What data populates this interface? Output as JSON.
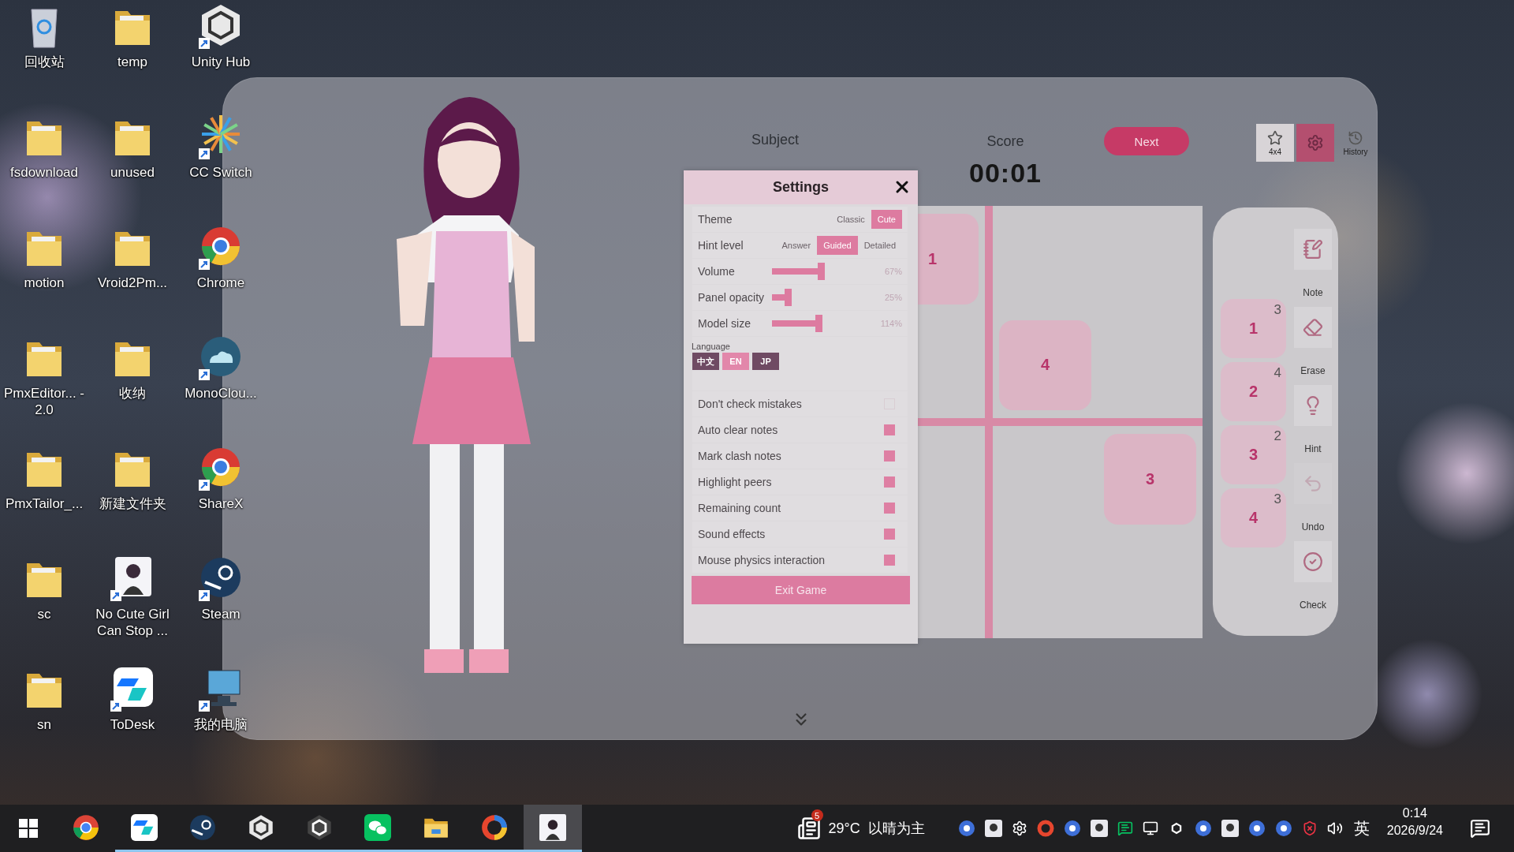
{
  "desktop_icons": [
    {
      "kind": "recycle-bin",
      "label": "回收站",
      "shortcut": false
    },
    {
      "kind": "folder",
      "label": "fsdownload",
      "shortcut": false
    },
    {
      "kind": "folder",
      "label": "motion",
      "shortcut": false
    },
    {
      "kind": "folder",
      "label": "PmxEditor... - 2.0",
      "shortcut": false
    },
    {
      "kind": "folder",
      "label": "PmxTailor_...",
      "shortcut": false
    },
    {
      "kind": "folder",
      "label": "sc",
      "shortcut": false
    },
    {
      "kind": "folder",
      "label": "sn",
      "shortcut": false
    },
    {
      "kind": "folder",
      "label": "temp",
      "shortcut": false
    },
    {
      "kind": "folder",
      "label": "unused",
      "shortcut": false
    },
    {
      "kind": "folder",
      "label": "Vroid2Pm...",
      "shortcut": false
    },
    {
      "kind": "folder",
      "label": "收纳",
      "shortcut": false
    },
    {
      "kind": "folder",
      "label": "新建文件夹",
      "shortcut": false
    },
    {
      "kind": "portrait",
      "label": "No Cute Girl Can Stop ...",
      "shortcut": true
    },
    {
      "kind": "remote",
      "label": "ToDesk",
      "shortcut": true
    },
    {
      "kind": "cube",
      "label": "Unity Hub",
      "shortcut": true
    },
    {
      "kind": "pinwheel",
      "label": "CC Switch",
      "shortcut": true
    },
    {
      "kind": "ring",
      "label": "Chrome",
      "shortcut": true
    },
    {
      "kind": "cloud",
      "label": "MonoClou...",
      "shortcut": true
    },
    {
      "kind": "ring",
      "label": "ShareX",
      "shortcut": true
    },
    {
      "kind": "steam",
      "label": "Steam",
      "shortcut": true
    },
    {
      "kind": "computer",
      "label": "我的电脑",
      "shortcut": true
    }
  ],
  "game": {
    "subject_label": "Subject",
    "score_label": "Score",
    "timer": "00:01",
    "next_button": "Next",
    "toolbar": [
      {
        "kind": "size",
        "label": "4x4",
        "selected": false
      },
      {
        "kind": "settings",
        "selected": true
      },
      {
        "kind": "history",
        "label": "History",
        "selected": false
      }
    ],
    "board": [
      [
        {
          "given": true,
          "value": "1"
        },
        {
          "given": false
        },
        {
          "given": false
        }
      ],
      [
        {
          "given": false
        },
        {
          "given": true,
          "value": "4"
        },
        {
          "given": false
        }
      ],
      [
        {
          "given": false
        },
        {
          "given": false
        },
        {
          "given": true,
          "value": "3"
        }
      ],
      [
        {
          "given": false
        },
        {
          "given": false
        },
        {
          "given": false
        }
      ]
    ],
    "number_pad": [
      {
        "digit": "1",
        "remaining": "3"
      },
      {
        "digit": "2",
        "remaining": "4"
      },
      {
        "digit": "3",
        "remaining": "2"
      },
      {
        "digit": "4",
        "remaining": "3"
      }
    ],
    "tools": [
      {
        "kind": "note",
        "label": "Note",
        "disabled": false
      },
      {
        "kind": "erase",
        "label": "Erase",
        "disabled": false
      },
      {
        "kind": "hint",
        "label": "Hint",
        "disabled": false
      },
      {
        "kind": "undo",
        "label": "Undo",
        "disabled": true
      },
      {
        "kind": "check",
        "label": "Check",
        "disabled": false
      }
    ]
  },
  "settings": {
    "title": "Settings",
    "rows": [
      {
        "kind": "choice",
        "label": "Theme",
        "options": [
          {
            "label": "Classic",
            "selected": false
          },
          {
            "label": "Cute",
            "selected": true
          }
        ]
      },
      {
        "kind": "choice",
        "label": "Hint level",
        "options": [
          {
            "label": "Answer",
            "selected": false
          },
          {
            "label": "Guided",
            "selected": true
          },
          {
            "label": "Detailed",
            "selected": false
          }
        ]
      },
      {
        "kind": "slider",
        "label": "Volume",
        "level": 0.67,
        "reading": "67%"
      },
      {
        "kind": "slider",
        "label": "Panel opacity",
        "level": 0.25,
        "reading": "25%"
      },
      {
        "kind": "slider",
        "label": "Model size",
        "level": 0.64,
        "reading": "114%"
      },
      {
        "kind": "language",
        "label": "Language",
        "options": [
          {
            "label": "中文",
            "selected": false
          },
          {
            "label": "EN",
            "selected": true
          },
          {
            "label": "JP",
            "selected": false
          }
        ]
      },
      {
        "kind": "toggle",
        "label": "Don't check mistakes",
        "checked": false
      },
      {
        "kind": "toggle",
        "label": "Auto clear notes",
        "checked": true
      },
      {
        "kind": "toggle",
        "label": "Mark clash notes",
        "checked": true
      },
      {
        "kind": "toggle",
        "label": "Highlight peers",
        "checked": true
      },
      {
        "kind": "toggle",
        "label": "Remaining count",
        "checked": true
      },
      {
        "kind": "toggle",
        "label": "Sound effects",
        "checked": true
      },
      {
        "kind": "toggle",
        "label": "Mouse physics interaction",
        "checked": true
      }
    ],
    "exit_button": "Exit Game"
  },
  "taskbar": {
    "apps": [
      {
        "kind": "browser",
        "running": false,
        "selected": false
      },
      {
        "kind": "remote",
        "running": true,
        "selected": false
      },
      {
        "kind": "steam",
        "running": true,
        "selected": false
      },
      {
        "kind": "cube",
        "running": true,
        "selected": false
      },
      {
        "kind": "cube-dark",
        "running": true,
        "selected": false
      },
      {
        "kind": "chat",
        "running": true,
        "selected": false
      },
      {
        "kind": "folder",
        "running": true,
        "selected": false
      },
      {
        "kind": "ring",
        "running": true,
        "selected": false
      },
      {
        "kind": "portrait",
        "running": true,
        "selected": true
      }
    ],
    "news_badge": "5",
    "temperature": "29°C",
    "weather": "以晴为主",
    "input_method": "英",
    "time": "0:14",
    "date": "2026/9/24"
  }
}
